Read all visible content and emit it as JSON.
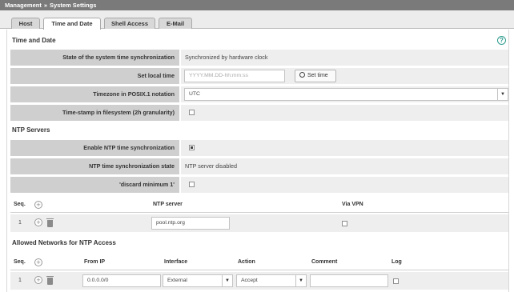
{
  "breadcrumb": {
    "root": "Management",
    "separator": "»",
    "current": "System Settings"
  },
  "tabs": [
    {
      "label": "Host",
      "active": false
    },
    {
      "label": "Time and Date",
      "active": true
    },
    {
      "label": "Shell Access",
      "active": false
    },
    {
      "label": "E-Mail",
      "active": false
    }
  ],
  "time_date": {
    "heading": "Time and Date",
    "help_glyph": "?",
    "sync_state_label": "State of the system time synchronization",
    "sync_state_value": "Synchronized by hardware clock",
    "set_local_label": "Set local time",
    "set_local_placeholder": "YYYY.MM.DD-hh:mm:ss",
    "set_time_button": "Set time",
    "timezone_label": "Timezone in POSIX.1 notation",
    "timezone_value": "UTC",
    "timestamp_label": "Time-stamp in filesystem (2h granularity)",
    "timestamp_checked": false
  },
  "ntp": {
    "heading": "NTP Servers",
    "enable_label": "Enable NTP time synchronization",
    "enable_checked": true,
    "state_label": "NTP time synchronization state",
    "state_value": "NTP server disabled",
    "discard_label": "'discard minimum 1'",
    "discard_checked": false,
    "columns": {
      "seq": "Seq.",
      "server": "NTP server",
      "vpn": "Via VPN"
    },
    "rows": [
      {
        "seq": "1",
        "server": "pool.ntp.org",
        "via_vpn": false
      }
    ]
  },
  "access": {
    "heading": "Allowed Networks for NTP Access",
    "columns": {
      "seq": "Seq.",
      "from_ip": "From IP",
      "interface": "Interface",
      "action": "Action",
      "comment": "Comment",
      "log": "Log"
    },
    "rows": [
      {
        "seq": "1",
        "from_ip": "0.0.0.0/0",
        "interface": "External",
        "action": "Accept",
        "comment": "",
        "log": false
      }
    ]
  },
  "icons": {
    "add": "plus-circle-icon",
    "delete": "trash-icon",
    "help": "help-circle-icon",
    "clock": "clock-icon",
    "dropdown": "chevron-down-icon"
  },
  "colors": {
    "title_bar": "#7a7a7a",
    "label_cell": "#cfcfcf",
    "value_cell": "#eeeeee",
    "help_accent": "#2e9c8f"
  }
}
